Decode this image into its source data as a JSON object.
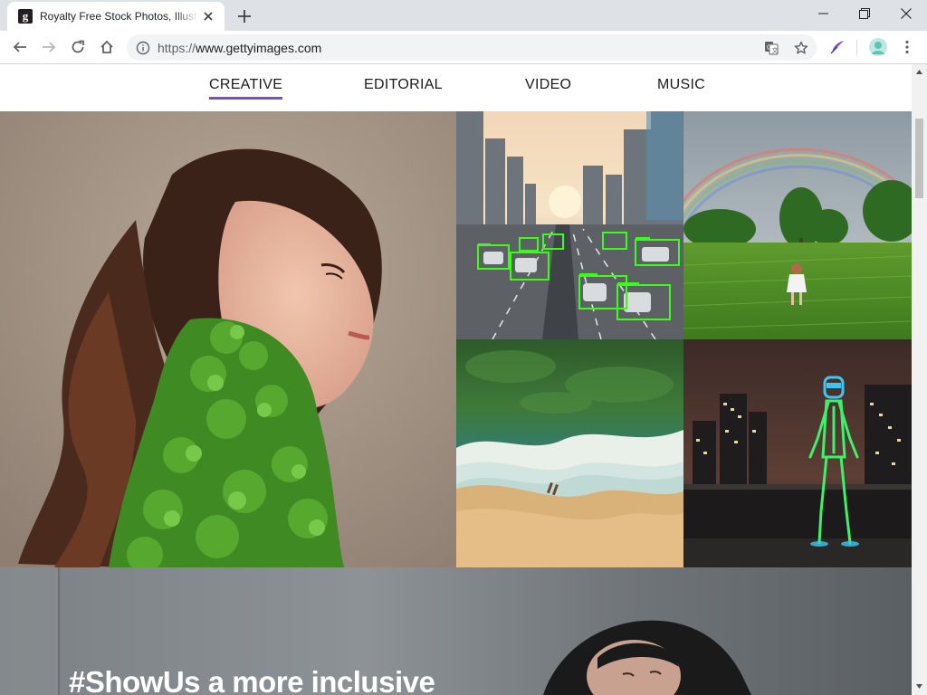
{
  "browser": {
    "tab_title": "Royalty Free Stock Photos, Illustrations, Vector Art",
    "favicon_letter": "g",
    "url_scheme": "https://",
    "url_host": "www.gettyimages.com"
  },
  "nav": {
    "items": [
      {
        "label": "CREATIVE",
        "active": true
      },
      {
        "label": "EDITORIAL",
        "active": false
      },
      {
        "label": "VIDEO",
        "active": false
      },
      {
        "label": "MUSIC",
        "active": false
      }
    ]
  },
  "hero": {
    "photos": [
      {
        "subject": "woman-with-moss-dress"
      },
      {
        "subject": "city-highway-object-detection"
      },
      {
        "subject": "child-in-field-rainbow"
      },
      {
        "subject": "aerial-beach-waves"
      },
      {
        "subject": "led-suit-figure-night-city"
      }
    ]
  },
  "banner": {
    "title": "#ShowUs a more inclusive"
  },
  "colors": {
    "accent": "#7c4dc2",
    "detection_box": "#39ff14"
  }
}
